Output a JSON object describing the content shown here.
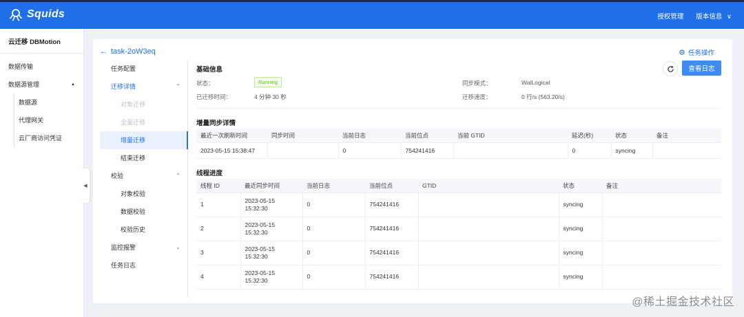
{
  "header": {
    "brand": "Squids",
    "license": "授权管理",
    "version": "版本信息",
    "version_chevron": "∨"
  },
  "sidebar": {
    "title": "云迁移 DBMotion",
    "items": [
      {
        "label": "数据传输"
      },
      {
        "label": "数据源管理",
        "chevron": "▲"
      }
    ],
    "sub_items": [
      {
        "label": "数据源"
      },
      {
        "label": "代理网关"
      },
      {
        "label": "云厂商访问凭证"
      }
    ],
    "collapse_arrow": "◀"
  },
  "page": {
    "back_arrow": "←",
    "task_name": "task-2oW3eq",
    "task_ops": "任务操作"
  },
  "subnav": {
    "task_config": "任务配置",
    "migration_detail": "迁移详情",
    "object_migration": "对象迁移",
    "full_migration": "全量迁移",
    "incremental_migration": "增量迁移",
    "end_migration": "结束迁移",
    "verification": "校验",
    "object_check": "对象校验",
    "data_check": "数据校验",
    "check_history": "校验历史",
    "monitor_alert": "监控报警",
    "task_log": "任务日志",
    "chevron_up": "⌃",
    "chevron_down": "⌄"
  },
  "basic": {
    "title": "基础信息",
    "status_label": "状态：",
    "status_value": "Running",
    "elapsed_label": "已迁移时间：",
    "elapsed_value": "4 分钟 30 秒",
    "sync_mode_label": "同步模式：",
    "sync_mode_value": "WalLogical",
    "speed_label": "迁移速度：",
    "speed_value": "0 行/s (563.20/s)",
    "view_log": "查看日志"
  },
  "incremental": {
    "title": "增量同步详情",
    "columns": [
      "最近一次刷新时间",
      "同步时间",
      "当前日志",
      "当前位点",
      "当前 GTID",
      "延迟(秒)",
      "状态",
      "备注"
    ],
    "rows": [
      [
        "2023-05-15 15:38:47",
        "",
        "0",
        "754241416",
        "",
        "0",
        "syncing",
        ""
      ]
    ]
  },
  "threads": {
    "title": "线程进度",
    "columns": [
      "线程 ID",
      "最近同步时间",
      "当前日志",
      "当前位点",
      "GTID",
      "状态",
      "备注"
    ],
    "rows": [
      {
        "id": "1",
        "date": "2023-05-15",
        "time": "15:32:30",
        "log": "0",
        "pos": "754241416",
        "gtid": "",
        "status": "syncing",
        "note": ""
      },
      {
        "id": "2",
        "date": "2023-05-15",
        "time": "15:32:30",
        "log": "0",
        "pos": "754241416",
        "gtid": "",
        "status": "syncing",
        "note": ""
      },
      {
        "id": "3",
        "date": "2023-05-15",
        "time": "15:32:30",
        "log": "0",
        "pos": "754241416",
        "gtid": "",
        "status": "syncing",
        "note": ""
      },
      {
        "id": "4",
        "date": "2023-05-15",
        "time": "15:32:30",
        "log": "0",
        "pos": "754241416",
        "gtid": "",
        "status": "syncing",
        "note": ""
      }
    ]
  },
  "watermark": "@稀土掘金技术社区",
  "colors": {
    "primary": "#1f6fe8",
    "running": "#52c41a"
  }
}
